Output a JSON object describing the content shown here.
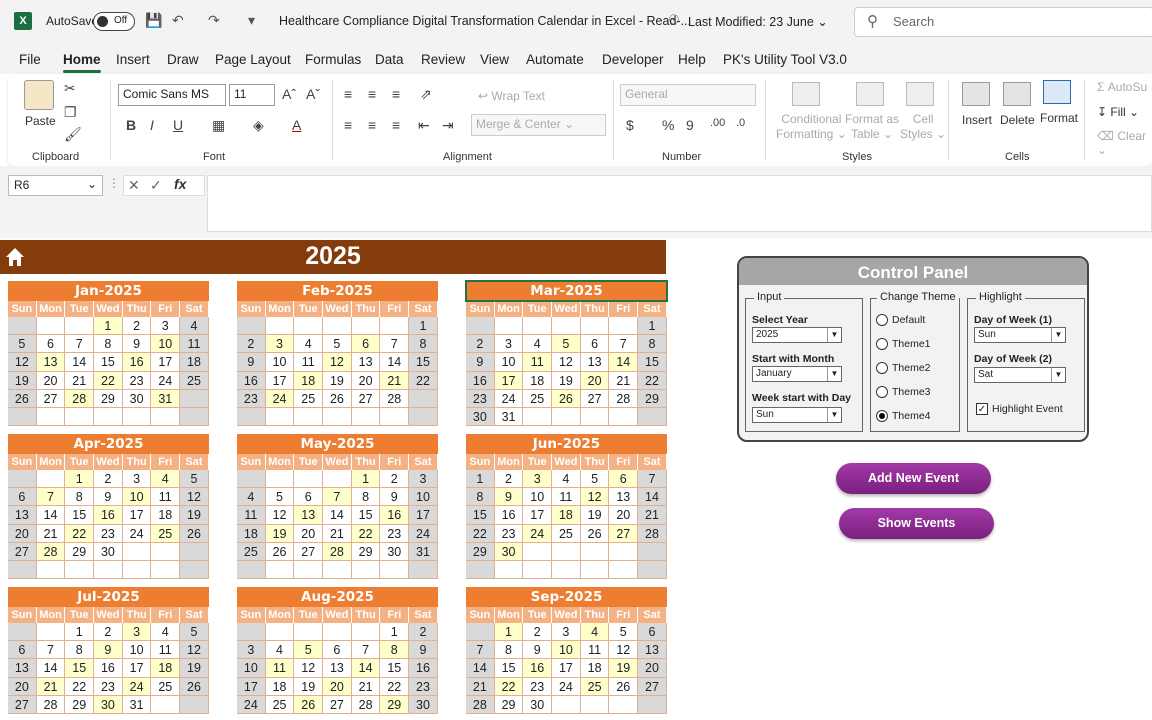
{
  "titlebar": {
    "autosave_label": "AutoSave",
    "autosave_state": "Off",
    "doc_title": "Healthcare Compliance Digital Transformation Calendar in Excel  -  Read-...",
    "modified": "Last Modified: 23 June",
    "search_placeholder": "Search"
  },
  "menu": [
    "File",
    "Home",
    "Insert",
    "Draw",
    "Page Layout",
    "Formulas",
    "Data",
    "Review",
    "View",
    "Automate",
    "Developer",
    "Help",
    "PK's Utility Tool V3.0"
  ],
  "ribbon": {
    "paste": "Paste",
    "clipboard": "Clipboard",
    "font_name": "Comic Sans MS",
    "font_size": "11",
    "font": "Font",
    "wrap_text": "Wrap Text",
    "merge_center": "Merge & Center",
    "alignment": "Alignment",
    "number_format": "General",
    "number": "Number",
    "conditional": "Conditional",
    "formatting": "Formatting",
    "format_as": "Format as",
    "table": "Table",
    "cell": "Cell",
    "styles_word": "Styles",
    "styles": "Styles",
    "insert": "Insert",
    "delete": "Delete",
    "format": "Format",
    "cells": "Cells",
    "autosum": "AutoSu",
    "fill": "Fill",
    "clear": "Clear"
  },
  "formula": {
    "namebox": "R6",
    "fx": "fx"
  },
  "calendar": {
    "year": "2025",
    "dow": [
      "Sun",
      "Mon",
      "Tue",
      "Wed",
      "Thu",
      "Fri",
      "Sat"
    ],
    "months": [
      {
        "name": "Jan-2025",
        "weeks": [
          [
            "",
            "",
            "",
            "1",
            "2",
            "3",
            "4"
          ],
          [
            "5",
            "6",
            "7",
            "8",
            "9",
            "10",
            "11"
          ],
          [
            "12",
            "13",
            "14",
            "15",
            "16",
            "17",
            "18"
          ],
          [
            "19",
            "20",
            "21",
            "22",
            "23",
            "24",
            "25"
          ],
          [
            "26",
            "27",
            "28",
            "29",
            "30",
            "31",
            ""
          ],
          [
            "",
            "",
            "",
            "",
            "",
            "",
            ""
          ]
        ],
        "hl": [
          "1",
          "4",
          "10",
          "13",
          "16",
          "22",
          "25",
          "28",
          "31"
        ]
      },
      {
        "name": "Feb-2025",
        "weeks": [
          [
            "",
            "",
            "",
            "",
            "",
            "",
            "1"
          ],
          [
            "2",
            "3",
            "4",
            "5",
            "6",
            "7",
            "8"
          ],
          [
            "9",
            "10",
            "11",
            "12",
            "13",
            "14",
            "15"
          ],
          [
            "16",
            "17",
            "18",
            "19",
            "20",
            "21",
            "22"
          ],
          [
            "23",
            "24",
            "25",
            "26",
            "27",
            "28",
            ""
          ],
          [
            "",
            "",
            "",
            "",
            "",
            "",
            ""
          ]
        ],
        "hl": [
          "3",
          "6",
          "9",
          "12",
          "15",
          "18",
          "21",
          "24"
        ]
      },
      {
        "name": "Mar-2025",
        "weeks": [
          [
            "",
            "",
            "",
            "",
            "",
            "",
            "1"
          ],
          [
            "2",
            "3",
            "4",
            "5",
            "6",
            "7",
            "8"
          ],
          [
            "9",
            "10",
            "11",
            "12",
            "13",
            "14",
            "15"
          ],
          [
            "16",
            "17",
            "18",
            "19",
            "20",
            "21",
            "22"
          ],
          [
            "23",
            "24",
            "25",
            "26",
            "27",
            "28",
            "29"
          ],
          [
            "30",
            "31",
            "",
            "",
            "",
            "",
            ""
          ]
        ],
        "hl": [
          "2",
          "5",
          "8",
          "11",
          "14",
          "17",
          "20",
          "23",
          "26",
          "29"
        ]
      },
      {
        "name": "Apr-2025",
        "weeks": [
          [
            "",
            "",
            "1",
            "2",
            "3",
            "4",
            "5"
          ],
          [
            "6",
            "7",
            "8",
            "9",
            "10",
            "11",
            "12"
          ],
          [
            "13",
            "14",
            "15",
            "16",
            "17",
            "18",
            "19"
          ],
          [
            "20",
            "21",
            "22",
            "23",
            "24",
            "25",
            "26"
          ],
          [
            "27",
            "28",
            "29",
            "30",
            "",
            "",
            ""
          ],
          [
            "",
            "",
            "",
            "",
            "",
            "",
            ""
          ]
        ],
        "hl": [
          "1",
          "4",
          "7",
          "10",
          "13",
          "16",
          "19",
          "22",
          "25",
          "28"
        ]
      },
      {
        "name": "May-2025",
        "weeks": [
          [
            "",
            "",
            "",
            "",
            "1",
            "2",
            "3"
          ],
          [
            "4",
            "5",
            "6",
            "7",
            "8",
            "9",
            "10"
          ],
          [
            "11",
            "12",
            "13",
            "14",
            "15",
            "16",
            "17"
          ],
          [
            "18",
            "19",
            "20",
            "21",
            "22",
            "23",
            "24"
          ],
          [
            "25",
            "26",
            "27",
            "28",
            "29",
            "30",
            "31"
          ],
          [
            "",
            "",
            "",
            "",
            "",
            "",
            ""
          ]
        ],
        "hl": [
          "1",
          "4",
          "7",
          "10",
          "13",
          "16",
          "19",
          "22",
          "25",
          "28",
          "31"
        ]
      },
      {
        "name": "Jun-2025",
        "weeks": [
          [
            "1",
            "2",
            "3",
            "4",
            "5",
            "6",
            "7"
          ],
          [
            "8",
            "9",
            "10",
            "11",
            "12",
            "13",
            "14"
          ],
          [
            "15",
            "16",
            "17",
            "18",
            "19",
            "20",
            "21"
          ],
          [
            "22",
            "23",
            "24",
            "25",
            "26",
            "27",
            "28"
          ],
          [
            "29",
            "30",
            "",
            "",
            "",
            "",
            ""
          ],
          [
            "",
            "",
            "",
            "",
            "",
            "",
            ""
          ]
        ],
        "hl": [
          "3",
          "6",
          "9",
          "12",
          "15",
          "18",
          "21",
          "24",
          "27",
          "30"
        ]
      },
      {
        "name": "Jul-2025",
        "weeks": [
          [
            "",
            "",
            "1",
            "2",
            "3",
            "4",
            "5"
          ],
          [
            "6",
            "7",
            "8",
            "9",
            "10",
            "11",
            "12"
          ],
          [
            "13",
            "14",
            "15",
            "16",
            "17",
            "18",
            "19"
          ],
          [
            "20",
            "21",
            "22",
            "23",
            "24",
            "25",
            "26"
          ],
          [
            "27",
            "28",
            "29",
            "30",
            "31",
            "",
            ""
          ]
        ],
        "hl": [
          "3",
          "6",
          "9",
          "12",
          "15",
          "18",
          "21",
          "24",
          "27",
          "30"
        ]
      },
      {
        "name": "Aug-2025",
        "weeks": [
          [
            "",
            "",
            "",
            "",
            "",
            "1",
            "2"
          ],
          [
            "3",
            "4",
            "5",
            "6",
            "7",
            "8",
            "9"
          ],
          [
            "10",
            "11",
            "12",
            "13",
            "14",
            "15",
            "16"
          ],
          [
            "17",
            "18",
            "19",
            "20",
            "21",
            "22",
            "23"
          ],
          [
            "24",
            "25",
            "26",
            "27",
            "28",
            "29",
            "30"
          ]
        ],
        "hl": [
          "2",
          "5",
          "8",
          "11",
          "14",
          "17",
          "20",
          "23",
          "26",
          "29"
        ]
      },
      {
        "name": "Sep-2025",
        "weeks": [
          [
            "",
            "1",
            "2",
            "3",
            "4",
            "5",
            "6"
          ],
          [
            "7",
            "8",
            "9",
            "10",
            "11",
            "12",
            "13"
          ],
          [
            "14",
            "15",
            "16",
            "17",
            "18",
            "19",
            "20"
          ],
          [
            "21",
            "22",
            "23",
            "24",
            "25",
            "26",
            "27"
          ],
          [
            "28",
            "29",
            "30",
            "",
            "",
            "",
            ""
          ]
        ],
        "hl": [
          "1",
          "4",
          "7",
          "10",
          "13",
          "16",
          "19",
          "22",
          "25",
          "28"
        ]
      }
    ]
  },
  "control_panel": {
    "title": "Control Panel",
    "input_title": "Input",
    "select_year_label": "Select Year",
    "select_year": "2025",
    "start_month_label": "Start with Month",
    "start_month": "January",
    "week_start_label": "Week start with Day",
    "week_start": "Sun",
    "theme_title": "Change Theme",
    "themes": [
      "Default",
      "Theme1",
      "Theme2",
      "Theme3",
      "Theme4"
    ],
    "selected_theme": "Theme4",
    "highlight_title": "Highlight",
    "dow1_label": "Day of Week (1)",
    "dow1": "Sun",
    "dow2_label": "Day of Week (2)",
    "dow2": "Sat",
    "highlight_event": "Highlight Event",
    "add_event": "Add New Event",
    "show_events": "Show Events"
  },
  "colors": {
    "header": "#843c0c",
    "month": "#ed7d31",
    "dow": "#f4b183",
    "weekend": "#d9d9d9",
    "highlight": "#ffffcc",
    "button": "#8b2a90"
  }
}
